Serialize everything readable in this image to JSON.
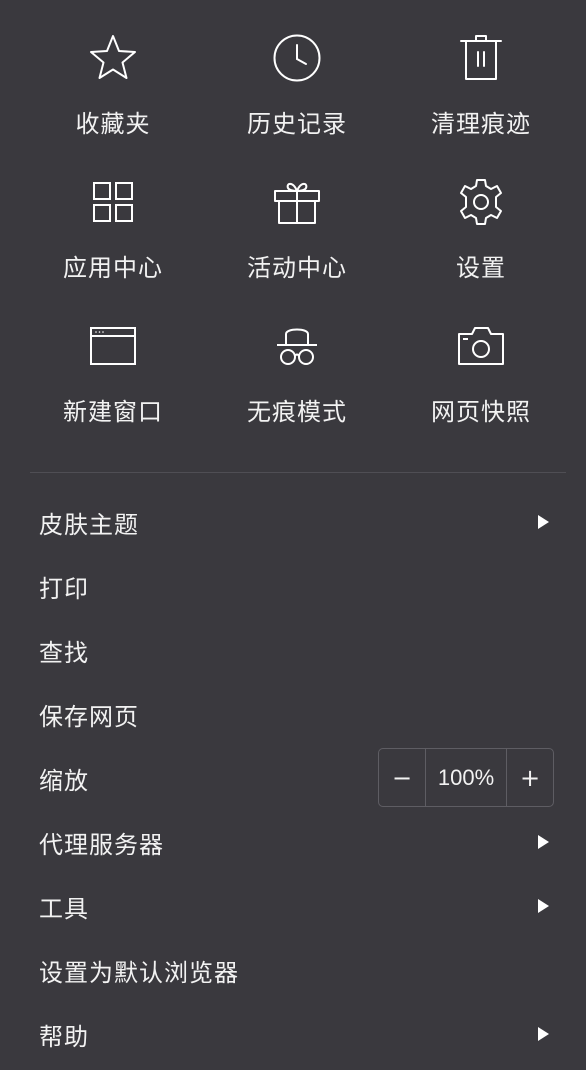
{
  "grid": {
    "items": [
      {
        "label": "收藏夹",
        "icon": "star-icon"
      },
      {
        "label": "历史记录",
        "icon": "clock-icon"
      },
      {
        "label": "清理痕迹",
        "icon": "trash-icon"
      },
      {
        "label": "应用中心",
        "icon": "app-grid-icon"
      },
      {
        "label": "活动中心",
        "icon": "gift-icon"
      },
      {
        "label": "设置",
        "icon": "gear-icon"
      },
      {
        "label": "新建窗口",
        "icon": "window-icon"
      },
      {
        "label": "无痕模式",
        "icon": "incognito-icon"
      },
      {
        "label": "网页快照",
        "icon": "camera-icon"
      }
    ]
  },
  "menu": {
    "items": [
      {
        "label": "皮肤主题",
        "submenu": true
      },
      {
        "label": "打印",
        "submenu": false
      },
      {
        "label": "查找",
        "submenu": false
      },
      {
        "label": "保存网页",
        "submenu": false
      },
      {
        "label": "缩放",
        "submenu": false
      },
      {
        "label": "代理服务器",
        "submenu": true
      },
      {
        "label": "工具",
        "submenu": true
      },
      {
        "label": "设置为默认浏览器",
        "submenu": false
      },
      {
        "label": "帮助",
        "submenu": true
      }
    ]
  },
  "zoom": {
    "minus": "−",
    "value": "100%",
    "plus": "+"
  },
  "colors": {
    "background": "#3a393e",
    "text": "#f2f2f2",
    "divider": "#4f4e54",
    "border": "#5e5d63"
  }
}
